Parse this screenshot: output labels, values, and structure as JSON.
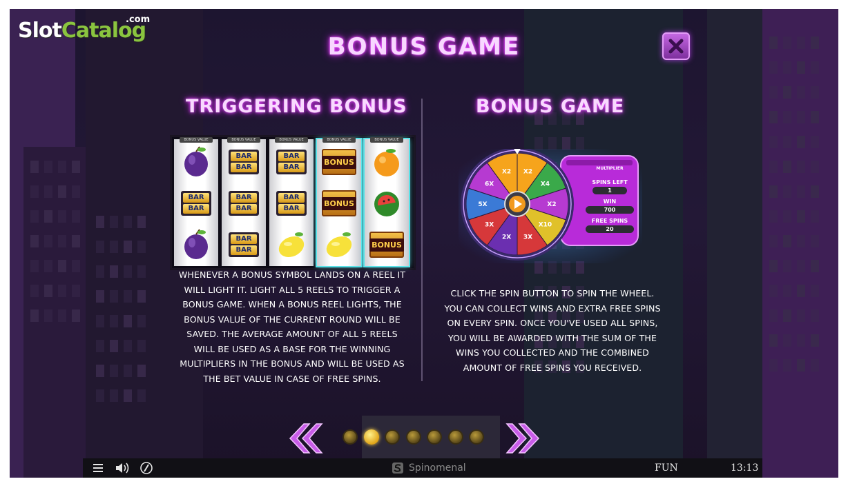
{
  "brand": {
    "logo_slot": "Slot",
    "logo_catalog": "Catalog",
    "logo_com": ".com"
  },
  "header": {
    "title": "BONUS GAME",
    "close_icon": "close-icon"
  },
  "left_section": {
    "heading": "TRIGGERING BONUS",
    "reel_tag": "BONUS VALUE",
    "reels": [
      {
        "lit": false,
        "symbols": [
          "plum",
          "bar",
          "plum"
        ]
      },
      {
        "lit": false,
        "symbols": [
          "bar",
          "bar",
          "bar"
        ]
      },
      {
        "lit": false,
        "symbols": [
          "bar",
          "bar",
          "lemon"
        ]
      },
      {
        "lit": true,
        "symbols": [
          "bonus",
          "bonus",
          "lemon"
        ]
      },
      {
        "lit": true,
        "symbols": [
          "orange",
          "watermelon",
          "bonus"
        ]
      }
    ],
    "bar_label": "BAR",
    "bonus_label": "BONUS",
    "description_lines": [
      "WHENEVER A BONUS SYMBOL LANDS ON A REEL IT",
      "WILL LIGHT IT. LIGHT ALL 5 REELS TO TRIGGER A",
      "BONUS GAME. WHEN A BONUS REEL LIGHTS, THE",
      "BONUS VALUE OF THE CURRENT ROUND WILL BE",
      "SAVED. THE AVERAGE AMOUNT OF ALL 5 REELS",
      "WILL BE USED AS A BASE FOR THE WINNING",
      "MULTIPLIERS IN THE BONUS AND WILL BE USED AS",
      "THE BET VALUE IN CASE OF FREE SPINS."
    ]
  },
  "right_section": {
    "heading": "BONUS GAME",
    "wheel": {
      "segments": [
        "X2",
        "X4",
        "X2",
        "X10",
        "3X",
        "2X",
        "3X",
        "5X",
        "6X",
        "X2"
      ],
      "side_panel": {
        "multiplier_label": "MULTIPLIER",
        "spins_left_label": "SPINS LEFT",
        "spins_left_value": "1",
        "win_label": "WIN",
        "win_value": "700",
        "free_spins_label": "FREE SPINS",
        "free_spins_value": "20"
      }
    },
    "description_lines": [
      "CLICK THE SPIN BUTTON TO SPIN THE WHEEL.",
      "YOU CAN COLLECT WINS AND EXTRA FREE SPINS",
      "ON EVERY SPIN. ONCE YOU'VE USED ALL SPINS,",
      "YOU WILL BE AWARDED WITH THE SUM OF THE",
      "WINS YOU COLLECTED AND THE COMBINED",
      "AMOUNT OF FREE SPINS YOU RECEIVED."
    ]
  },
  "pagination": {
    "total_pages": 7,
    "current_page": 2
  },
  "status_bar": {
    "brand": "Spinomenal",
    "mode": "FUN",
    "time": "13:13"
  },
  "colors": {
    "neon_pink": "#e64bff",
    "accent_purple": "#a13bd1",
    "gold": "#ffd34a"
  }
}
